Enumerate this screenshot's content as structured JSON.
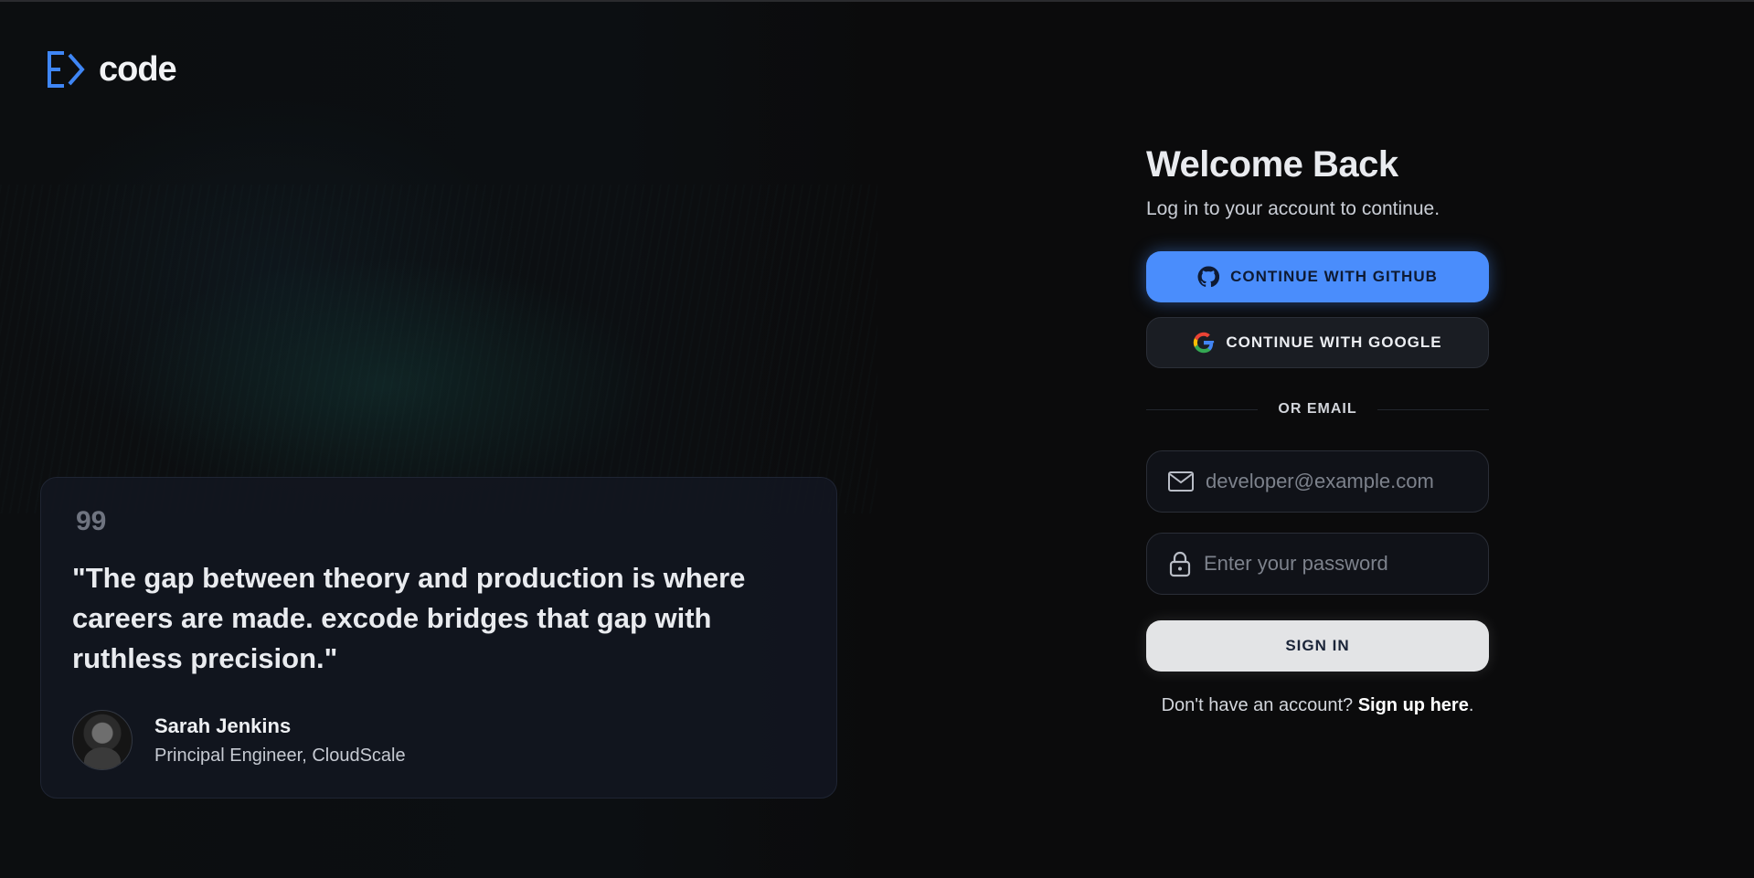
{
  "brand": {
    "name": "code"
  },
  "testimonial": {
    "quote_mark": "99",
    "quote": "\"The gap between theory and production is where careers are made. excode bridges that gap with ruthless precision.\"",
    "author_name": "Sarah Jenkins",
    "author_role": "Principal Engineer, CloudScale"
  },
  "auth": {
    "title": "Welcome Back",
    "subtitle": "Log in to your account to continue.",
    "github_label": "CONTINUE WITH GITHUB",
    "google_label": "CONTINUE WITH GOOGLE",
    "divider_label": "OR EMAIL",
    "email_placeholder": "developer@example.com",
    "password_placeholder": "Enter your password",
    "signin_label": "SIGN IN",
    "signup_prompt": "Don't have an account? ",
    "signup_link": "Sign up here",
    "signup_suffix": "."
  },
  "colors": {
    "background": "#0b0b0c",
    "accent": "#4a8dfc",
    "card": "#12161f"
  },
  "icons": [
    "logo-mark-icon",
    "github-icon",
    "google-icon",
    "mail-icon",
    "lock-icon",
    "quote-icon"
  ]
}
